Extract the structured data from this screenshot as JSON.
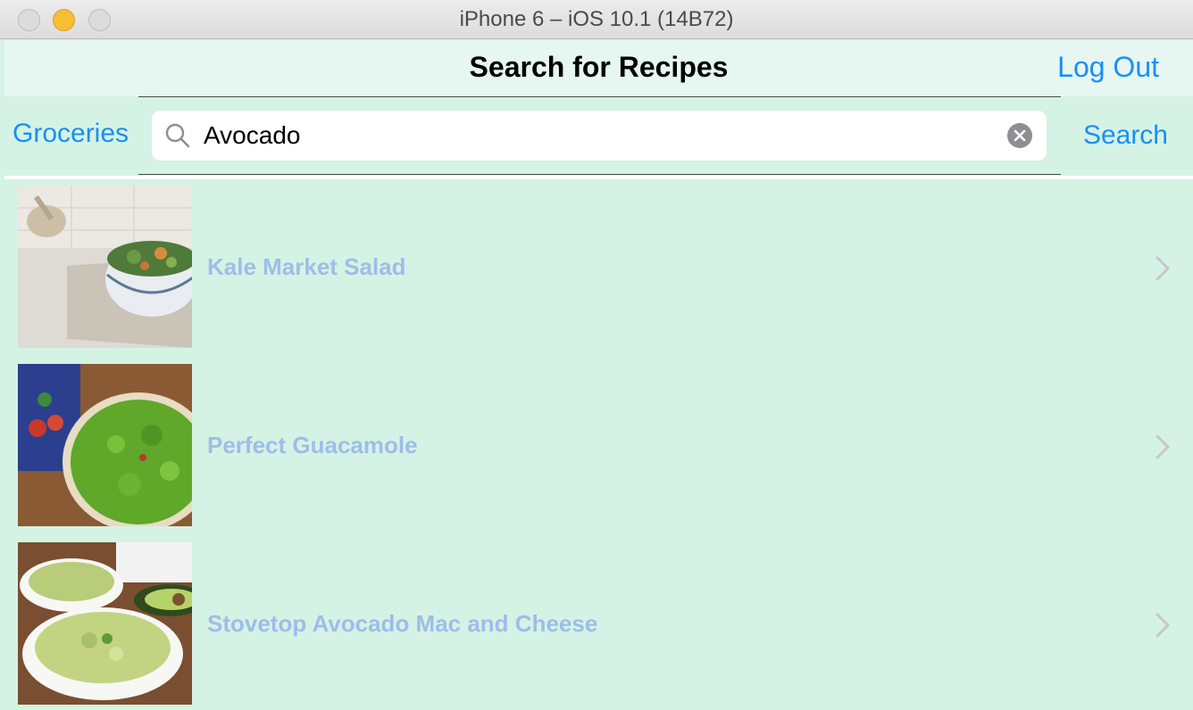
{
  "window": {
    "title": "iPhone 6 – iOS 10.1 (14B72)"
  },
  "navbar": {
    "title": "Search for Recipes",
    "right_button": "Log Out"
  },
  "search": {
    "left_button": "Groceries",
    "value": "Avocado",
    "placeholder": "",
    "action_button": "Search"
  },
  "recipes": [
    {
      "title": "Kale Market Salad"
    },
    {
      "title": "Perfect Guacamole"
    },
    {
      "title": "Stovetop Avocado Mac and Cheese"
    }
  ],
  "colors": {
    "accent": "#1b8ef5",
    "background": "#d4f3e5",
    "row_text": "#9fbde8"
  },
  "icons": [
    "search-icon",
    "clear-icon",
    "chevron-right-icon"
  ]
}
